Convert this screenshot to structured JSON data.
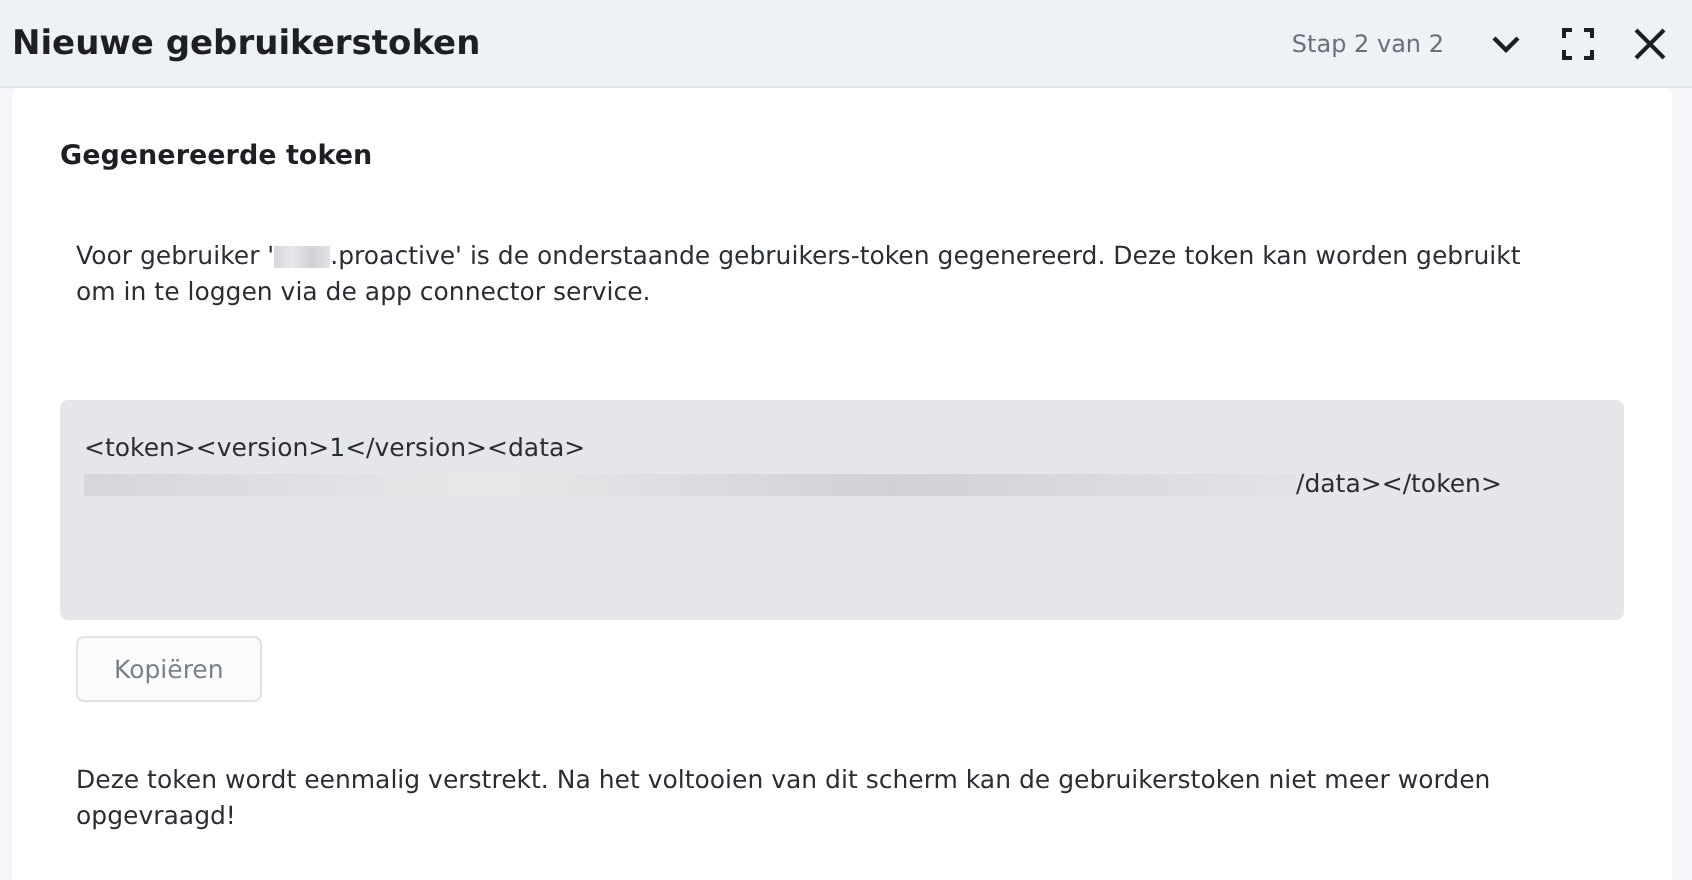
{
  "header": {
    "title": "Nieuwe gebruikerstoken",
    "step": "Stap 2 van 2"
  },
  "section": {
    "title": "Gegenereerde token",
    "intro_before": "Voor gebruiker '",
    "intro_after": ".proactive' is de onderstaande gebruikers-token gegenereerd. Deze token kan worden gebruikt om in te loggen via de app connector service.",
    "token_start": "<token><version>1</version><data>",
    "token_end": "/data></token>",
    "copy_button": "Kopiëren",
    "note": "Deze token wordt eenmalig verstrekt. Na het voltooien van dit scherm kan de gebruikerstoken niet meer worden opgevraagd!"
  }
}
